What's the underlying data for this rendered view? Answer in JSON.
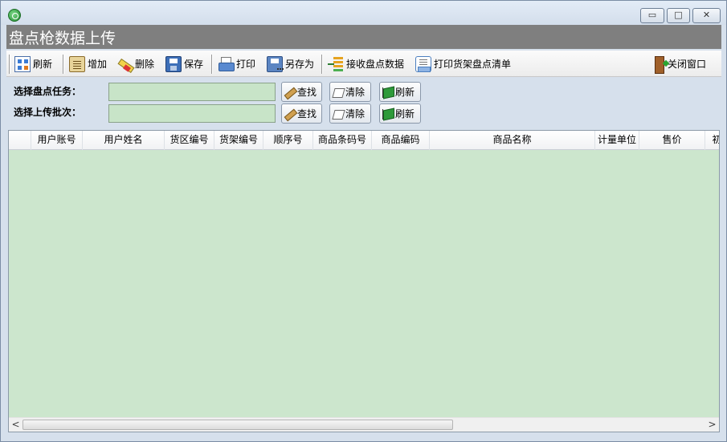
{
  "window": {
    "title": "盘点枪数据上传",
    "controls": {
      "minimize": "▭",
      "maximize": "□",
      "close": "✕"
    }
  },
  "toolbar": {
    "refresh": "刷新",
    "add": "增加",
    "delete": "删除",
    "save": "保存",
    "print": "打印",
    "save_as": "另存为",
    "receive": "接收盘点数据",
    "print_shelf": "打印货架盘点清单",
    "close_window": "关闭窗口"
  },
  "filters": {
    "task_label": "选择盘点任务：",
    "task_value": "",
    "batch_label": "选择上传批次：",
    "batch_value": "",
    "find": "查找",
    "clear": "清除",
    "refresh": "刷新"
  },
  "grid": {
    "columns": [
      "用户账号",
      "用户姓名",
      "货区编号",
      "货架编号",
      "顺序号",
      "商品条码号",
      "商品编码",
      "商品名称",
      "计量单位",
      "售价",
      "初"
    ],
    "rows": [],
    "scroll": {
      "left_arrow": "<",
      "right_arrow": ">"
    }
  }
}
